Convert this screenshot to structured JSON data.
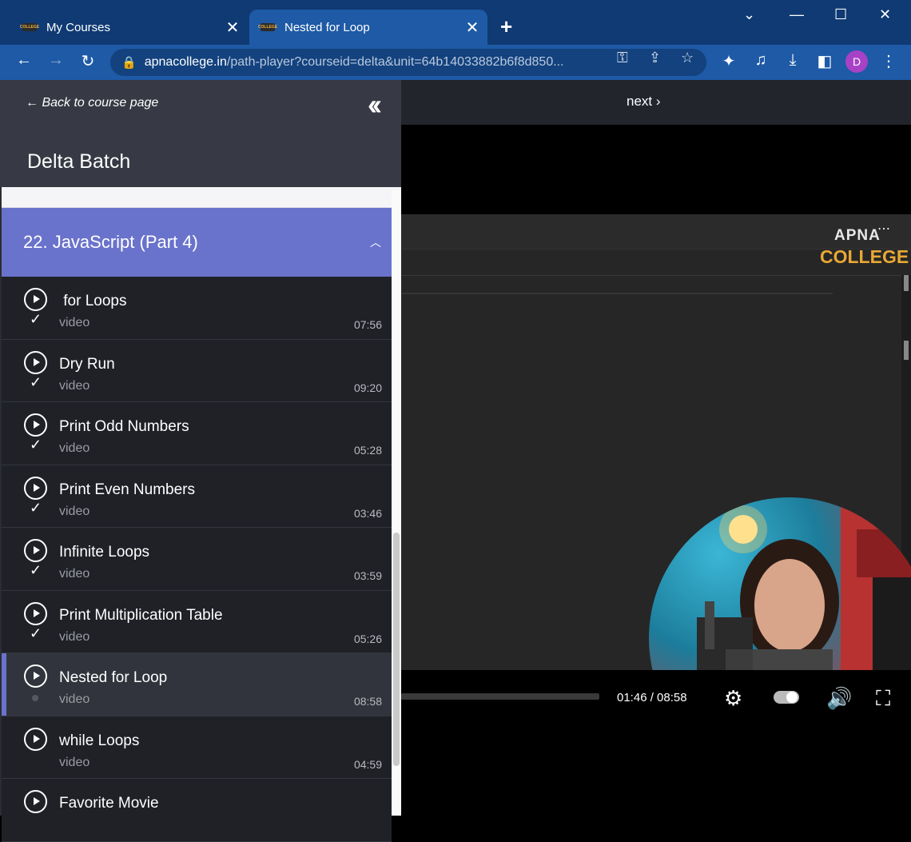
{
  "browser": {
    "tabs": [
      {
        "title": "My Courses",
        "favicon": "COLLEGE"
      },
      {
        "title": "Nested for Loop",
        "favicon": "COLLEGE"
      }
    ],
    "url_host": "apnacollege.in",
    "url_path": "/path-player?courseid=delta&unit=64b14033882b6f8d850...",
    "profile_initial": "D"
  },
  "sidebar": {
    "back_label": "← Back to course page",
    "batch_title": "Delta Batch",
    "section_title": "22. JavaScript (Part 4)",
    "lessons": [
      {
        "title": " for Loops",
        "type": "video",
        "duration": "07:56",
        "completed": true
      },
      {
        "title": "Dry Run",
        "type": "video",
        "duration": "09:20",
        "completed": true
      },
      {
        "title": "Print Odd Numbers",
        "type": "video",
        "duration": "05:28",
        "completed": true
      },
      {
        "title": "Print Even Numbers",
        "type": "video",
        "duration": "03:46",
        "completed": true
      },
      {
        "title": "Infinite Loops",
        "type": "video",
        "duration": "03:59",
        "completed": true
      },
      {
        "title": "Print Multiplication Table",
        "type": "video",
        "duration": "05:26",
        "completed": true
      },
      {
        "title": "Nested for Loop",
        "type": "video",
        "duration": "08:58",
        "completed": false,
        "active": true
      },
      {
        "title": "while Loops",
        "type": "video",
        "duration": "04:59",
        "completed": false
      },
      {
        "title": "Favorite Movie",
        "type": "",
        "duration": "",
        "completed": false
      }
    ]
  },
  "main": {
    "next_label": "next ›",
    "logo_top": "APNA",
    "logo_bottom": "COLLEGE",
    "time_display": "01:46 / 08:58",
    "progress": 0.2
  }
}
